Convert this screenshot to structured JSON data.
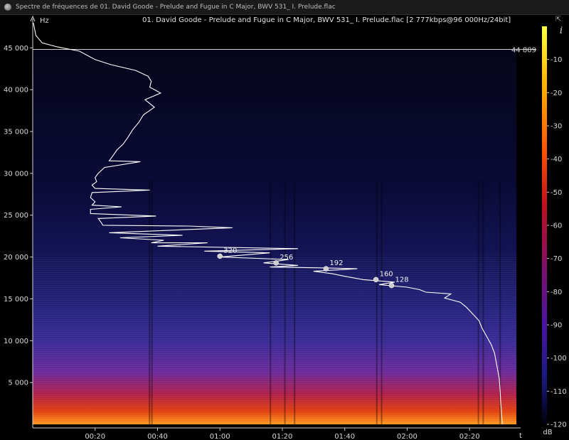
{
  "window": {
    "title": "Spectre de fréquences de 01. David Goode - Prelude and Fugue in C Major, BWV 531_ I. Prelude.flac"
  },
  "header": {
    "file_info": "01. David Goode - Prelude and Fugue in C Major, BWV 531_ I. Prelude.flac [2 777kbps@96 000Hz/24bit]"
  },
  "colors": {
    "background": "#000000",
    "spectrogram_low": "#0a0a2a",
    "spectrogram_mid": "#3a1a8a",
    "spectrogram_high": "#ff7a00",
    "contour_line": "#ffffff"
  },
  "icons": [
    "app-icon",
    "expand-icon",
    "info-icon"
  ],
  "chart_data": {
    "type": "heatmap",
    "xlabel": "t",
    "ylabel": "Hz",
    "colorbar_label": "dB",
    "xlim_seconds": [
      0,
      155
    ],
    "ylim_hz": [
      0,
      48000
    ],
    "x_ticks": [
      "00:20",
      "00:40",
      "01:00",
      "01:20",
      "01:40",
      "02:00",
      "02:20"
    ],
    "x_tick_seconds": [
      20,
      40,
      60,
      80,
      100,
      120,
      140
    ],
    "y_ticks": [
      "5 000",
      "10 000",
      "15 000",
      "20 000",
      "25 000",
      "30 000",
      "35 000",
      "40 000",
      "45 000"
    ],
    "y_tick_values": [
      5000,
      10000,
      15000,
      20000,
      25000,
      30000,
      35000,
      40000,
      45000
    ],
    "colorbar_ticks": [
      "-10",
      "-20",
      "-30",
      "-40",
      "-50",
      "-60",
      "-70",
      "-80",
      "-90",
      "-100",
      "-110",
      "-120"
    ],
    "colorbar_values": [
      -10,
      -20,
      -30,
      -40,
      -50,
      -60,
      -70,
      -80,
      -90,
      -100,
      -110,
      -120
    ],
    "colorbar_range_db": [
      0,
      -120
    ],
    "nyquist_line": {
      "label": "44 809",
      "value_hz": 44809
    },
    "bitrate_markers": [
      {
        "label": "320",
        "t": 60,
        "hz": 20100
      },
      {
        "label": "256",
        "t": 78,
        "hz": 19300
      },
      {
        "label": "192",
        "t": 94,
        "hz": 18600
      },
      {
        "label": "160",
        "t": 110,
        "hz": 17300
      },
      {
        "label": "128",
        "t": 115,
        "hz": 16600
      }
    ],
    "cutoff_curve": [
      [
        0.2,
        48000
      ],
      [
        1,
        46500
      ],
      [
        3,
        45600
      ],
      [
        8,
        45100
      ],
      [
        15,
        44600
      ],
      [
        20,
        43600
      ],
      [
        25,
        43000
      ],
      [
        33,
        42300
      ],
      [
        37,
        41600
      ],
      [
        38,
        41000
      ],
      [
        37.5,
        40300
      ],
      [
        41,
        39600
      ],
      [
        36,
        38800
      ],
      [
        39,
        37900
      ],
      [
        35.5,
        37000
      ],
      [
        34,
        36100
      ],
      [
        32,
        35200
      ],
      [
        30.5,
        34300
      ],
      [
        29,
        33500
      ],
      [
        27,
        32800
      ],
      [
        25.5,
        32000
      ],
      [
        24.5,
        31500
      ],
      [
        34.5,
        31400
      ],
      [
        23,
        30700
      ],
      [
        21,
        30000
      ],
      [
        20,
        29500
      ],
      [
        20.5,
        29000
      ],
      [
        19,
        28600
      ],
      [
        20,
        28200
      ],
      [
        37.5,
        28000
      ],
      [
        19,
        27700
      ],
      [
        18.5,
        27100
      ],
      [
        20,
        26600
      ],
      [
        19,
        26200
      ],
      [
        28.5,
        26000
      ],
      [
        18.5,
        25700
      ],
      [
        18.5,
        25200
      ],
      [
        39.5,
        24900
      ],
      [
        21,
        24600
      ],
      [
        22,
        24100
      ],
      [
        22.5,
        23800
      ],
      [
        50,
        23700
      ],
      [
        64,
        23500
      ],
      [
        24.5,
        22900
      ],
      [
        48,
        22600
      ],
      [
        28,
        22300
      ],
      [
        42,
        22000
      ],
      [
        38,
        21700
      ],
      [
        56,
        21700
      ],
      [
        40,
        21300
      ],
      [
        85,
        21000
      ],
      [
        55,
        20700
      ],
      [
        76,
        20500
      ],
      [
        60,
        20000
      ],
      [
        82,
        19700
      ],
      [
        74,
        19300
      ],
      [
        85,
        19000
      ],
      [
        76,
        18800
      ],
      [
        94,
        18700
      ],
      [
        104,
        18600
      ],
      [
        90,
        18300
      ],
      [
        96,
        18000
      ],
      [
        100,
        17700
      ],
      [
        106,
        17300
      ],
      [
        116,
        17000
      ],
      [
        111,
        16700
      ],
      [
        120,
        16400
      ],
      [
        124,
        16100
      ],
      [
        126,
        15800
      ],
      [
        134,
        15600
      ],
      [
        132,
        15100
      ],
      [
        137,
        14600
      ],
      [
        139,
        14000
      ],
      [
        141,
        13200
      ],
      [
        143,
        12400
      ],
      [
        144,
        11500
      ],
      [
        145.5,
        10500
      ],
      [
        147,
        9500
      ],
      [
        148,
        8500
      ],
      [
        148.5,
        7500
      ],
      [
        149,
        6500
      ],
      [
        149.5,
        5500
      ],
      [
        149.8,
        4000
      ],
      [
        150,
        2500
      ],
      [
        150.3,
        1000
      ],
      [
        150.5,
        0
      ]
    ]
  }
}
